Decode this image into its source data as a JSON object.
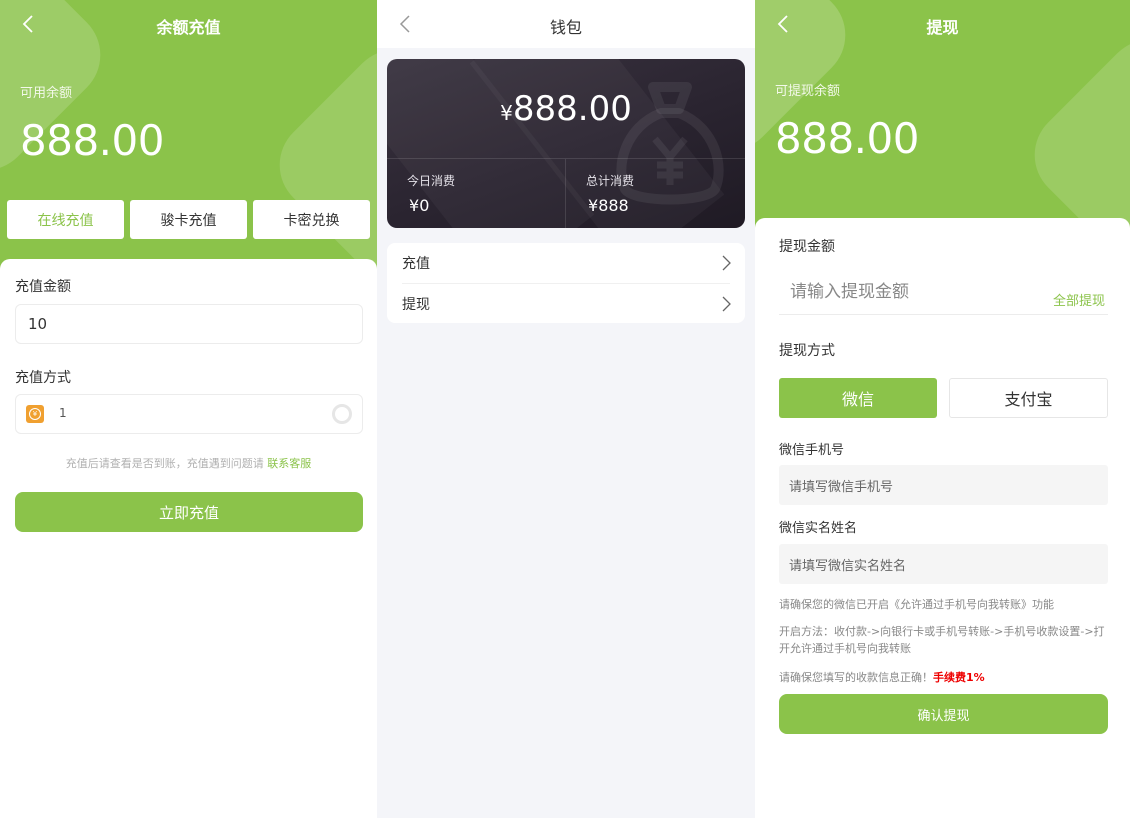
{
  "recharge": {
    "title": "余额充值",
    "balance_label": "可用余额",
    "balance_value": "888.00",
    "tabs": [
      {
        "label": "在线充值",
        "active": true
      },
      {
        "label": "骏卡充值",
        "active": false
      },
      {
        "label": "卡密兑换",
        "active": false
      }
    ],
    "amount_label": "充值金额",
    "amount_value": "10",
    "method_label": "充值方式",
    "method_option": "1",
    "hint_text": "充值后请查看是否到账，充值遇到问题请",
    "hint_link": "联系客服",
    "submit_label": "立即充值"
  },
  "wallet": {
    "title": "钱包",
    "currency": "¥",
    "balance": "888.00",
    "today_label": "今日消费",
    "today_value": "0",
    "total_label": "总计消费",
    "total_value": "888",
    "menu": [
      {
        "label": "充值"
      },
      {
        "label": "提现"
      }
    ]
  },
  "withdraw": {
    "title": "提现",
    "balance_label": "可提现余额",
    "balance_value": "888.00",
    "amount_label": "提现金额",
    "amount_placeholder": "请输入提现金额",
    "withdraw_all": "全部提现",
    "method_label": "提现方式",
    "methods": [
      {
        "label": "微信",
        "active": true
      },
      {
        "label": "支付宝",
        "active": false
      }
    ],
    "phone_label": "微信手机号",
    "phone_placeholder": "请填写微信手机号",
    "name_label": "微信实名姓名",
    "name_placeholder": "请填写微信实名姓名",
    "note1": "请确保您的微信已开启《允许通过手机号向我转账》功能",
    "note2": "开启方法：收付款->向银行卡或手机号转账->手机号收款设置->打开允许通过手机号向我转账",
    "note3": "请确保您填写的收款信息正确！",
    "fee_text": "手续费1%",
    "submit_label": "确认提现"
  },
  "colors": {
    "accent": "#8bc34a",
    "card_dark": "#2a2430",
    "fee_red": "#e00000"
  }
}
